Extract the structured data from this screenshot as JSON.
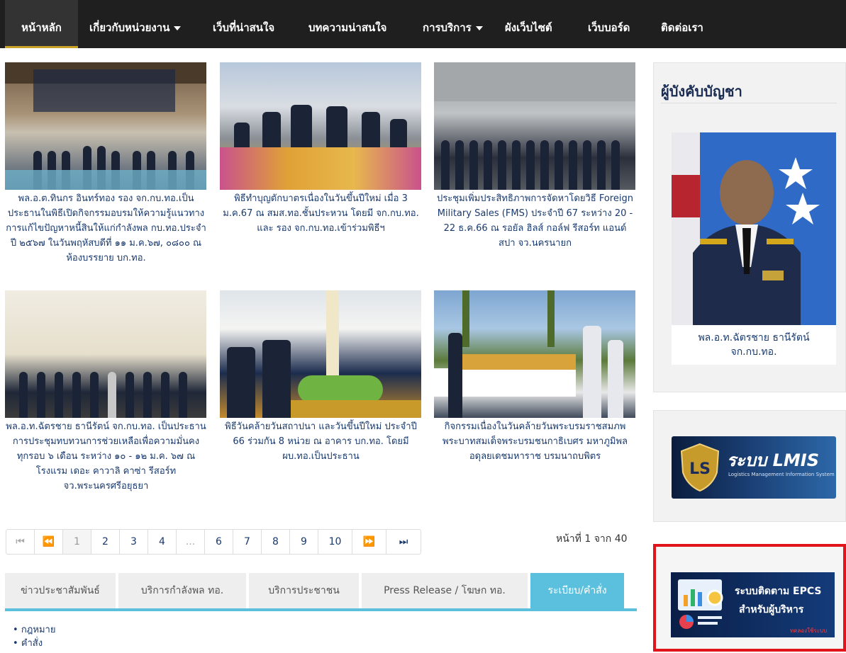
{
  "nav": {
    "home": "หน้าหลัก",
    "about": "เกี่ยวกับหน่วยงาน",
    "websites": "เว็บที่น่าสนใจ",
    "articles": "บทความน่าสนใจ",
    "services": "การบริการ",
    "sitemap": "ผังเว็บไซต์",
    "webboard": "เว็บบอร์ด",
    "contact": "ติดต่อเรา"
  },
  "news": [
    {
      "caption": "พล.อ.ต.ทินกร อินทร์ทอง รอง จก.กบ.ทอ.เป็นประธานในพิธีเปิดกิจกรรมอบรมให้ความรู้แนวทางการแก้ไขปัญหาหนี้สินให้แก่กำลังพล กบ.ทอ.ประจำปี ๒๕๖๗ ในวันพฤหัสบดีที่ ๑๑ ม.ค.๖๗, ๐๘๐๐ ณ ห้องบรรยาย บก.ทอ."
    },
    {
      "caption": "พิธีทำบุญตักบาตรเนื่องในวันขึ้นปีใหม่ เมื่อ 3 ม.ค.67 ณ สมส.ทอ.ชั้นประหวน โดยมี จก.กบ.ทอ. และ รอง จก.กบ.ทอ.เข้าร่วมพิธีฯ"
    },
    {
      "caption": "ประชุมเพิ่มประสิทธิภาพการจัดหาโดยวิธี Foreign Military Sales (FMS) ประจำปี 67 ระหว่าง 20 - 22 ธ.ค.66 ณ รอยัล ฮิลส์ กอล์ฟ รีสอร์ท แอนด์ สปา จว.นครนายก"
    },
    {
      "caption": "พล.อ.ท.ฉัตรชาย ธานีรัตน์ จก.กบ.ทอ. เป็นประธานการประชุมทบทวนการช่วยเหลือเพื่อความมั่นคงทุกรอบ ๖ เดือน ระหว่าง ๑๐ - ๑๒ ม.ค. ๖๗ ณ โรงแรม เดอะ คาวาลิ คาซ่า รีสอร์ท จว.พระนครศรีอยุธยา"
    },
    {
      "caption": "พิธีวันคล้ายวันสถาปนา และวันขึ้นปีใหม่ ประจำปี 66 ร่วมกัน 8 หน่วย ณ อาคาร บก.ทอ. โดยมี ผบ.ทอ.เป็นประธาน"
    },
    {
      "caption": "กิจกรรมเนื่องในวันคล้ายวันพระบรมราชสมภพ พระบาทสมเด็จพระบรมชนกาธิเบศร มหาภูมิพลอดุลยเดชมหาราช บรมนาถบพิตร"
    }
  ],
  "pagination": {
    "pages": [
      "1",
      "2",
      "3",
      "4",
      "...",
      "6",
      "7",
      "8",
      "9",
      "10"
    ],
    "current": 1,
    "info": "หน้าที่ 1 จาก 40"
  },
  "tabs": [
    "ข่าวประชาสัมพันธ์",
    "บริการกำลังพล ทอ.",
    "บริการประชาชน",
    "Press Release / โฆษก ทอ.",
    "ระเบียบ/คำสั่ง"
  ],
  "tab_list": [
    "กฎหมาย",
    "คำสั่ง"
  ],
  "sidebar": {
    "commander_title": "ผู้บังคับบัญชา",
    "commander_name_1": "พล.อ.ท.ฉัตรชาย  ธานีรัตน์",
    "commander_name_2": "จก.กบ.ทอ.",
    "lmis_text": "ระบบ LMIS",
    "lmis_sub": "Logistics Management Information System",
    "epcs_line1": "ระบบติดตาม EPCS",
    "epcs_line2": "สำหรับผู้บริหาร",
    "epcs_link": "ทดลองใช้ระบบ"
  },
  "colors": {
    "navbar": "#1f1f1f",
    "accent_tab": "#5bc0de",
    "link": "#1a3a6e",
    "highlight_border": "#e2141b"
  }
}
